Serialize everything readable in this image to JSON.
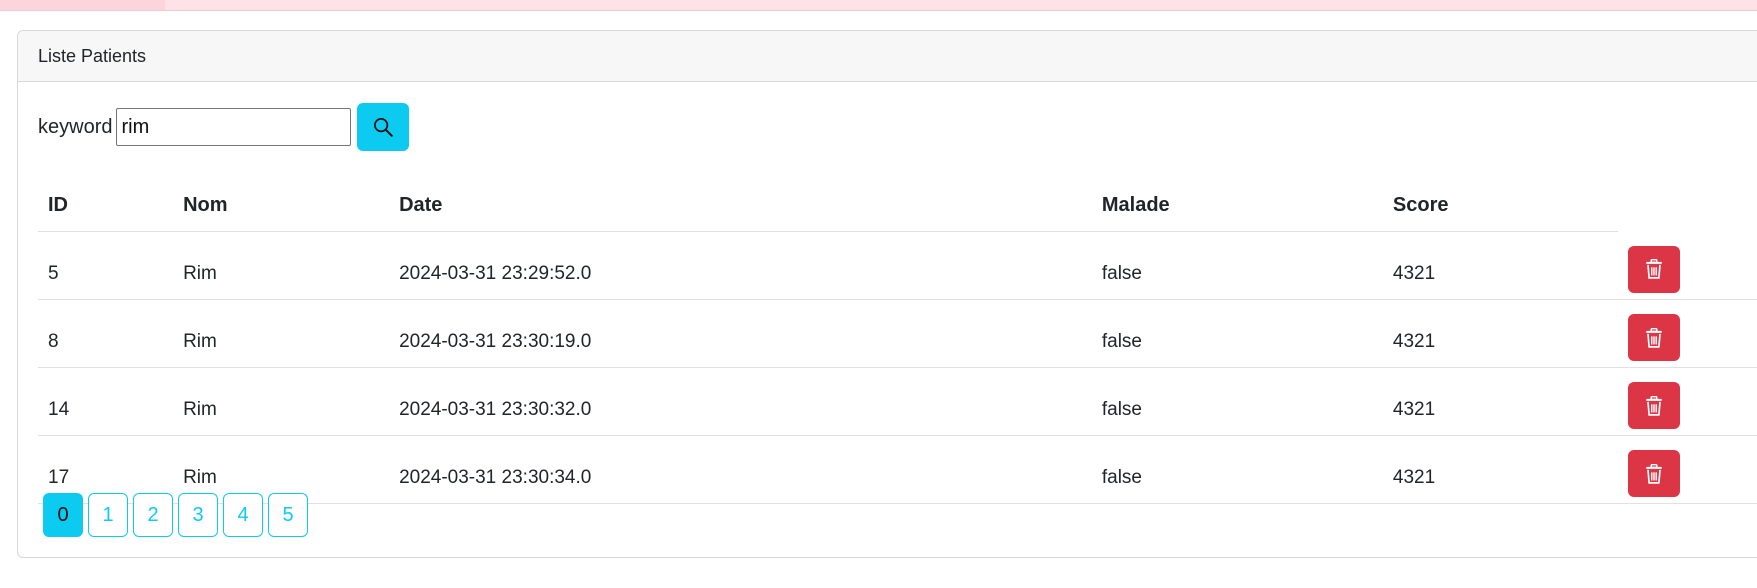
{
  "card": {
    "title": "Liste Patients"
  },
  "search": {
    "label": "keyword",
    "value": "rim",
    "button_icon": "search-icon"
  },
  "table": {
    "columns": [
      "ID",
      "Nom",
      "Date",
      "Malade",
      "Score"
    ],
    "rows": [
      {
        "id": "5",
        "nom": "Rim",
        "date": "2024-03-31 23:29:52.0",
        "malade": "false",
        "score": "4321"
      },
      {
        "id": "8",
        "nom": "Rim",
        "date": "2024-03-31 23:30:19.0",
        "malade": "false",
        "score": "4321"
      },
      {
        "id": "14",
        "nom": "Rim",
        "date": "2024-03-31 23:30:32.0",
        "malade": "false",
        "score": "4321"
      },
      {
        "id": "17",
        "nom": "Rim",
        "date": "2024-03-31 23:30:34.0",
        "malade": "false",
        "score": "4321"
      }
    ],
    "row_action_icon": "trash-icon"
  },
  "pagination": {
    "pages": [
      "0",
      "1",
      "2",
      "3",
      "4",
      "5"
    ],
    "current": "0"
  },
  "colors": {
    "accent": "#0dcaf0",
    "danger": "#dc3545",
    "top_strip": "#fde3e8"
  }
}
